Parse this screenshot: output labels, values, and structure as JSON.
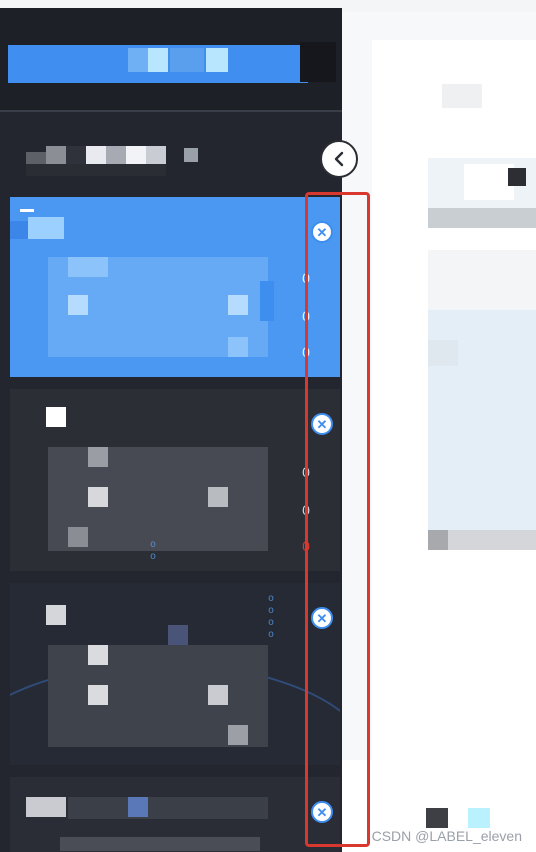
{
  "window": {
    "collapse_icon": "chevron-left-icon",
    "close_icon": "close-icon"
  },
  "cards": [
    {
      "state": "active",
      "side_marks": [
        "0",
        "0",
        "0"
      ]
    },
    {
      "state": "inactive",
      "side_marks": [
        "0",
        "0",
        "0"
      ]
    },
    {
      "state": "inactive",
      "side_marks": [
        "I",
        "I",
        ""
      ]
    },
    {
      "state": "inactive",
      "side_marks": []
    }
  ],
  "watermark": "CSDN @LABEL_eleven",
  "colors": {
    "accent": "#3d8ef0",
    "panel_dark": "#23262e",
    "highlight": "#d9382f"
  }
}
